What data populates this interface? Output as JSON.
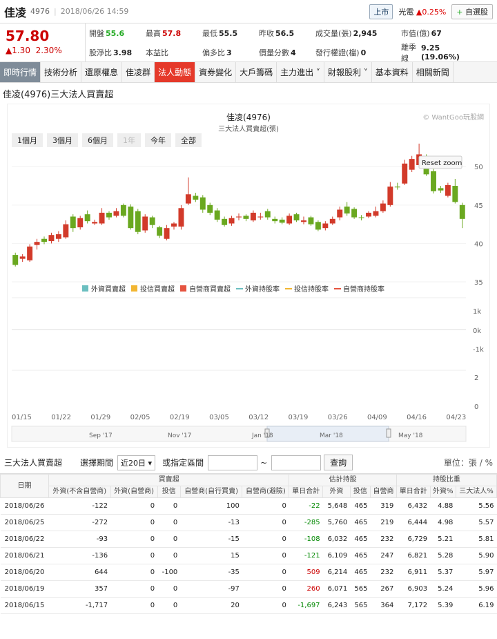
{
  "header": {
    "name": "佳凌",
    "code": "4976",
    "datetime": "2018/06/26 14:59",
    "market": "上市",
    "industry_name": "光電",
    "industry_change": "▲0.25%",
    "add_label": "自選股"
  },
  "quote": {
    "price": "57.80",
    "change": "▲1.30",
    "change_pct": "2.30%",
    "stats": [
      {
        "label": "開盤",
        "value": "55.6",
        "color": "g"
      },
      {
        "label": "最高",
        "value": "57.8",
        "color": "r"
      },
      {
        "label": "最低",
        "value": "55.5",
        "color": ""
      },
      {
        "label": "昨收",
        "value": "56.5",
        "color": ""
      },
      {
        "label": "成交量(張)",
        "value": "2,945",
        "color": ""
      },
      {
        "label": "市值(億)",
        "value": "67",
        "color": ""
      },
      {
        "label": "股淨比",
        "value": "3.98",
        "color": ""
      },
      {
        "label": "本益比",
        "value": "",
        "color": ""
      },
      {
        "label": "偏多比",
        "value": "3",
        "color": ""
      },
      {
        "label": "價量分數",
        "value": "4",
        "color": ""
      },
      {
        "label": "發行權證(檔)",
        "value": "0",
        "color": ""
      },
      {
        "label": "離季線",
        "value": "9.25 (19.06%)",
        "color": ""
      }
    ]
  },
  "tabs": [
    "即時行情",
    "技術分析",
    "還原權息",
    "佳凌群",
    "法人動態",
    "資券變化",
    "大戶籌碼",
    "主力進出 ˅",
    "財報股利 ˅",
    "基本資料",
    "相關新聞"
  ],
  "section_title": "佳凌(4976)三大法人買賣超",
  "chart": {
    "title": "佳凌(4976)",
    "subtitle": "三大法人買賣超(張)",
    "credit": "© WantGoo玩股網",
    "reset": "Reset zoom",
    "ranges": [
      "1個月",
      "3個月",
      "6個月",
      "1年",
      "今年",
      "全部"
    ],
    "legend": [
      {
        "name": "外資買賣超",
        "color": "#6bbfc0"
      },
      {
        "name": "投信買賣超",
        "color": "#f2b632"
      },
      {
        "name": "自營商買賣超",
        "color": "#e5533f"
      },
      {
        "name": "外資持股率",
        "color": "#6bbfc0"
      },
      {
        "name": "投信持股率",
        "color": "#f2b632"
      },
      {
        "name": "自營商持股率",
        "color": "#e5533f"
      }
    ],
    "price_ticks": [
      "50",
      "45",
      "40",
      "35"
    ],
    "flow_ticks": [
      "1k",
      "0k",
      "-1k"
    ],
    "ratio_ticks": [
      "2",
      "0"
    ],
    "x_ticks": [
      "01/15",
      "01/22",
      "01/29",
      "02/05",
      "02/19",
      "03/05",
      "03/12",
      "03/19",
      "03/26",
      "04/09",
      "04/16",
      "04/23"
    ],
    "nav_ticks": [
      "Sep '17",
      "Nov '17",
      "Jan '18",
      "Mar '18",
      "May '18"
    ]
  },
  "chart_data": {
    "type": "candlestick",
    "ylim": [
      35,
      52
    ],
    "candles": [
      [
        38.5,
        37.2,
        38.8,
        37.0
      ],
      [
        38.0,
        38.3,
        38.6,
        37.6
      ],
      [
        37.8,
        39.6,
        39.9,
        37.6
      ],
      [
        39.8,
        40.2,
        40.6,
        39.2
      ],
      [
        40.6,
        40.2,
        40.9,
        39.9
      ],
      [
        40.3,
        41.1,
        41.4,
        40.0
      ],
      [
        40.6,
        41.2,
        41.6,
        40.2
      ],
      [
        40.8,
        42.5,
        43.0,
        40.6
      ],
      [
        43.5,
        42.0,
        43.8,
        41.5
      ],
      [
        42.1,
        43.3,
        43.6,
        41.8
      ],
      [
        43.8,
        42.9,
        44.3,
        42.6
      ],
      [
        42.6,
        42.8,
        43.1,
        42.4
      ],
      [
        42.6,
        44.0,
        44.6,
        42.4
      ],
      [
        44.0,
        43.4,
        44.2,
        43.1
      ],
      [
        43.6,
        44.2,
        44.6,
        43.4
      ],
      [
        45.0,
        43.6,
        45.2,
        43.4
      ],
      [
        44.8,
        42.0,
        45.1,
        41.8
      ],
      [
        44.2,
        41.5,
        44.5,
        41.2
      ],
      [
        41.7,
        43.5,
        43.8,
        41.4
      ],
      [
        43.4,
        42.4,
        43.6,
        42.0
      ],
      [
        42.1,
        41.0,
        42.3,
        40.7
      ],
      [
        40.6,
        42.0,
        42.4,
        40.4
      ],
      [
        42.2,
        42.6,
        42.8,
        41.8
      ],
      [
        42.2,
        44.6,
        45.0,
        41.8
      ],
      [
        45.2,
        46.4,
        48.6,
        45.0
      ],
      [
        46.2,
        45.7,
        46.6,
        45.4
      ],
      [
        46.0,
        44.4,
        46.3,
        44.0
      ],
      [
        45.0,
        44.0,
        45.3,
        43.7
      ],
      [
        44.3,
        43.1,
        44.6,
        42.8
      ],
      [
        43.2,
        42.4,
        43.5,
        42.2
      ],
      [
        42.6,
        43.3,
        43.6,
        42.3
      ],
      [
        43.4,
        43.5,
        43.9,
        43.0
      ],
      [
        43.6,
        43.2,
        43.8,
        42.9
      ],
      [
        43.0,
        44.0,
        44.3,
        42.8
      ],
      [
        43.4,
        43.5,
        44.0,
        43.1
      ],
      [
        44.2,
        43.4,
        44.5,
        43.1
      ],
      [
        43.2,
        42.9,
        43.5,
        42.6
      ],
      [
        43.1,
        42.7,
        43.4,
        42.5
      ],
      [
        42.6,
        43.6,
        43.9,
        42.4
      ],
      [
        43.8,
        43.0,
        44.0,
        42.8
      ],
      [
        42.8,
        43.0,
        43.5,
        42.5
      ],
      [
        43.4,
        42.5,
        43.6,
        42.3
      ],
      [
        42.8,
        41.8,
        43.0,
        41.6
      ],
      [
        42.0,
        42.6,
        42.9,
        41.7
      ],
      [
        42.6,
        43.2,
        43.5,
        42.4
      ],
      [
        43.4,
        44.4,
        44.8,
        43.0
      ],
      [
        44.8,
        43.9,
        45.4,
        43.6
      ],
      [
        44.5,
        43.4,
        44.7,
        43.2
      ],
      [
        43.4,
        43.3,
        43.7,
        43.0
      ],
      [
        43.5,
        44.0,
        44.2,
        43.3
      ],
      [
        43.6,
        44.2,
        44.8,
        43.4
      ],
      [
        44.2,
        45.2,
        45.6,
        44.0
      ],
      [
        45.0,
        47.4,
        48.0,
        44.8
      ],
      [
        47.4,
        47.3,
        47.9,
        47.0
      ],
      [
        47.8,
        50.4,
        50.9,
        47.6
      ],
      [
        49.6,
        51.0,
        51.4,
        49.3
      ],
      [
        50.2,
        51.6,
        53.0,
        50.0
      ],
      [
        51.4,
        49.0,
        51.6,
        48.8
      ],
      [
        49.4,
        46.8,
        49.7,
        46.5
      ],
      [
        47.2,
        46.9,
        47.5,
        46.6
      ],
      [
        46.2,
        47.6,
        47.9,
        46.0
      ],
      [
        47.5,
        45.4,
        48.4,
        45.2
      ],
      [
        45.0,
        43.2,
        45.3,
        42.0
      ]
    ]
  },
  "table": {
    "title": "三大法人買賣超",
    "period_label": "選擇期間",
    "period_value": "近20日",
    "range_label": "或指定區間",
    "tilde": "~",
    "query": "查詢",
    "unit": "單位：張 / %",
    "group_headers": [
      "日期",
      "買賣超",
      "估計持股",
      "持股比重"
    ],
    "sub_headers": [
      "外資(不含自營商)",
      "外資(自營商)",
      "投信",
      "自營商(自行買賣)",
      "自營商(避險)",
      "單日合計",
      "外資",
      "投信",
      "自營商",
      "單日合計",
      "外資%",
      "三大法人%"
    ],
    "rows": [
      [
        "2018/06/26",
        "-122",
        "0",
        "0",
        "100",
        "0",
        "-22",
        "5,648",
        "465",
        "319",
        "6,432",
        "4.88",
        "5.56"
      ],
      [
        "2018/06/25",
        "-272",
        "0",
        "0",
        "-13",
        "0",
        "-285",
        "5,760",
        "465",
        "219",
        "6,444",
        "4.98",
        "5.57"
      ],
      [
        "2018/06/22",
        "-93",
        "0",
        "0",
        "-15",
        "0",
        "-108",
        "6,032",
        "465",
        "232",
        "6,729",
        "5.21",
        "5.81"
      ],
      [
        "2018/06/21",
        "-136",
        "0",
        "0",
        "15",
        "0",
        "-121",
        "6,109",
        "465",
        "247",
        "6,821",
        "5.28",
        "5.90"
      ],
      [
        "2018/06/20",
        "644",
        "0",
        "-100",
        "-35",
        "0",
        "509",
        "6,214",
        "465",
        "232",
        "6,911",
        "5.37",
        "5.97"
      ],
      [
        "2018/06/19",
        "357",
        "0",
        "0",
        "-97",
        "0",
        "260",
        "6,071",
        "565",
        "267",
        "6,903",
        "5.24",
        "5.96"
      ],
      [
        "2018/06/15",
        "-1,717",
        "0",
        "0",
        "20",
        "0",
        "-1,697",
        "6,243",
        "565",
        "364",
        "7,172",
        "5.39",
        "6.19"
      ]
    ]
  }
}
